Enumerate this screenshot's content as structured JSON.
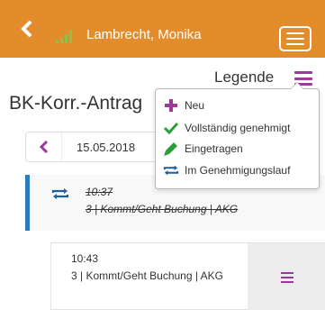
{
  "header": {
    "user_name": "Lambrecht, Monika",
    "bg_color": "#e38c2b"
  },
  "legend": {
    "label": "Legende",
    "items": [
      {
        "label": "Neu",
        "icon": "plus-icon",
        "color": "#9c3a9b"
      },
      {
        "label": "Vollständig genehmigt",
        "icon": "check-icon",
        "color": "#2e9e3a"
      },
      {
        "label": "Eingetragen",
        "icon": "pencil-icon",
        "color": "#2e9e3a"
      },
      {
        "label": "Im Genehmigungslauf",
        "icon": "sync-arrows-icon",
        "color": "#1f5f9c"
      }
    ]
  },
  "page": {
    "title": "BK-Korr.-Antrag"
  },
  "date_nav": {
    "date": "15.05.2018"
  },
  "entries": [
    {
      "time": "10:37",
      "description": "3 | Kommt/Geht Buchung | AKG",
      "status_icon": "sync-arrows-icon"
    },
    {
      "time": "10:43",
      "description": "3 | Kommt/Geht Buchung | AKG"
    }
  ]
}
